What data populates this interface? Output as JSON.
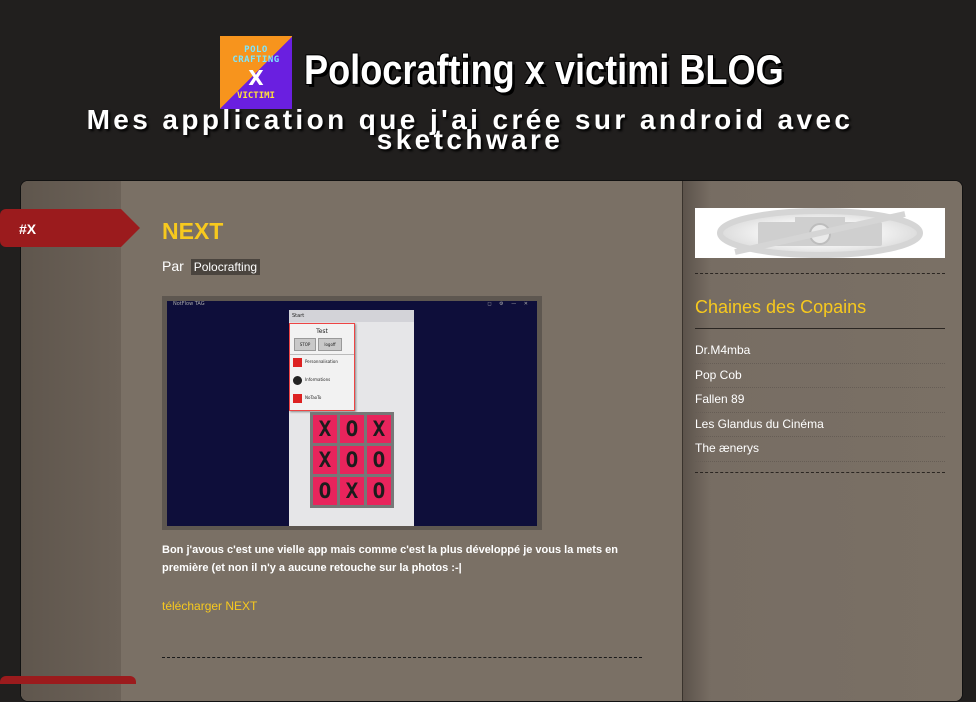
{
  "header": {
    "logo_lines": [
      "POLO",
      "CRAFTING",
      "X",
      "VICTIMI"
    ],
    "title": "Polocrafting x victimi BLOG",
    "description": "Mes application que j'ai crée sur android avec sketchware"
  },
  "post": {
    "date_tag": "#X",
    "title": "NEXT",
    "by_prefix": "Par",
    "author": "Polocrafting",
    "screenshot": {
      "app_name": "NotFlow TAG",
      "start_label": "Start",
      "menu_title": "Test",
      "menu_buttons": [
        "STOP",
        "logoff"
      ],
      "menu_items": [
        "Personnalisation",
        "Informations",
        "NoTaoTo"
      ],
      "grid": [
        "X",
        "O",
        "X",
        "X",
        "O",
        "O",
        "O",
        "X",
        "O"
      ]
    },
    "body": "Bon j'avous c'est une vielle app mais comme c'est la plus développé je vous la mets en première (et non il n'y a aucune retouche sur la photos :-|",
    "download_link": "télécharger NEXT"
  },
  "sidebar": {
    "widget_title": "Chaines des Copains",
    "links": [
      "Dr.M4mba",
      "Pop Cob",
      "Fallen 89",
      "Les Glandus du Cinéma",
      "The ænerys"
    ]
  },
  "colors": {
    "accent": "#f7c91e",
    "tag_red": "#9b1b1d",
    "page_bg": "#211f1e",
    "content_bg": "#7a7065",
    "tile": "#e8245c"
  }
}
